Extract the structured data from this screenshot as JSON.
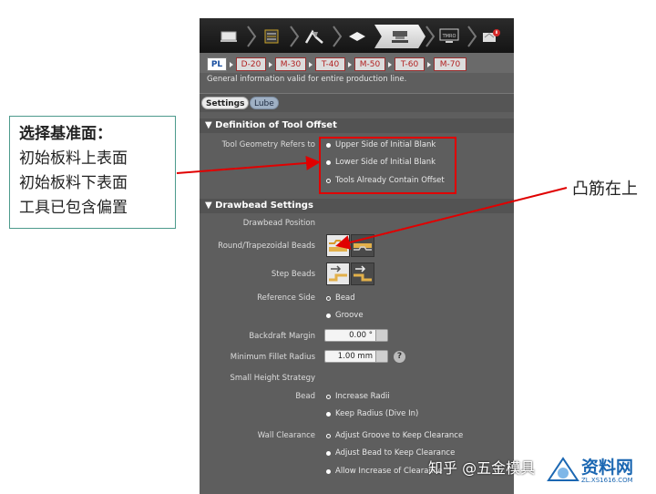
{
  "toolbar": {
    "icons": [
      "blank-icon",
      "drawbead-icon",
      "punch-icon",
      "binder-icon",
      "tool-offset-icon",
      "monitor-icon",
      "simulation-run-icon"
    ],
    "active_index": 4,
    "monitor_text": "TMRO"
  },
  "tabs": [
    {
      "label": "PL",
      "active": true
    },
    {
      "label": "D-20",
      "active": false
    },
    {
      "label": "M-30",
      "active": false
    },
    {
      "label": "T-40",
      "active": false
    },
    {
      "label": "M-50",
      "active": false
    },
    {
      "label": "T-60",
      "active": false
    },
    {
      "label": "M-70",
      "active": false
    }
  ],
  "info_text": "General information valid for entire production line.",
  "subtabs": {
    "settings": "Settings",
    "lube": "Lube"
  },
  "tool_offset": {
    "header": "Definition of Tool Offset",
    "label": "Tool Geometry Refers to",
    "options": [
      "Upper Side of Initial Blank",
      "Lower Side of Initial Blank",
      "Tools Already Contain Offset"
    ],
    "selected": 2
  },
  "drawbead": {
    "header": "Drawbead Settings",
    "position_label": "Drawbead Position",
    "round_label": "Round/Trapezoidal Beads",
    "step_label": "Step Beads",
    "reference_label": "Reference Side",
    "reference_options": [
      "Bead",
      "Groove"
    ],
    "reference_selected": 0,
    "backdraft_label": "Backdraft Margin",
    "backdraft_value": "0.00 °",
    "fillet_label": "Minimum Fillet Radius",
    "fillet_value": "1.00 mm",
    "help": "?",
    "small_height_label": "Small Height Strategy",
    "bead_label": "Bead",
    "bead_options": [
      "Increase Radii",
      "Keep Radius (Dive In)"
    ],
    "bead_selected": 0,
    "wall_label": "Wall Clearance",
    "wall_options": [
      "Adjust Groove to Keep Clearance",
      "Adjust Bead to Keep Clearance",
      "Allow Increase of Clearance"
    ],
    "wall_selected": 0
  },
  "callout": {
    "title": "选择基准面：",
    "lines": [
      "初始板料上表面",
      "初始板料下表面",
      "工具已包含偏置"
    ]
  },
  "side_note": "凸筋在上",
  "watermark": {
    "zhihu": "知乎 @五金模具",
    "site": "资料网",
    "site_url": "ZL.XS1616.COM"
  },
  "colors": {
    "annotation_red": "#e00000",
    "tab_red": "#b22222",
    "callout_border": "#4d9a8c"
  }
}
